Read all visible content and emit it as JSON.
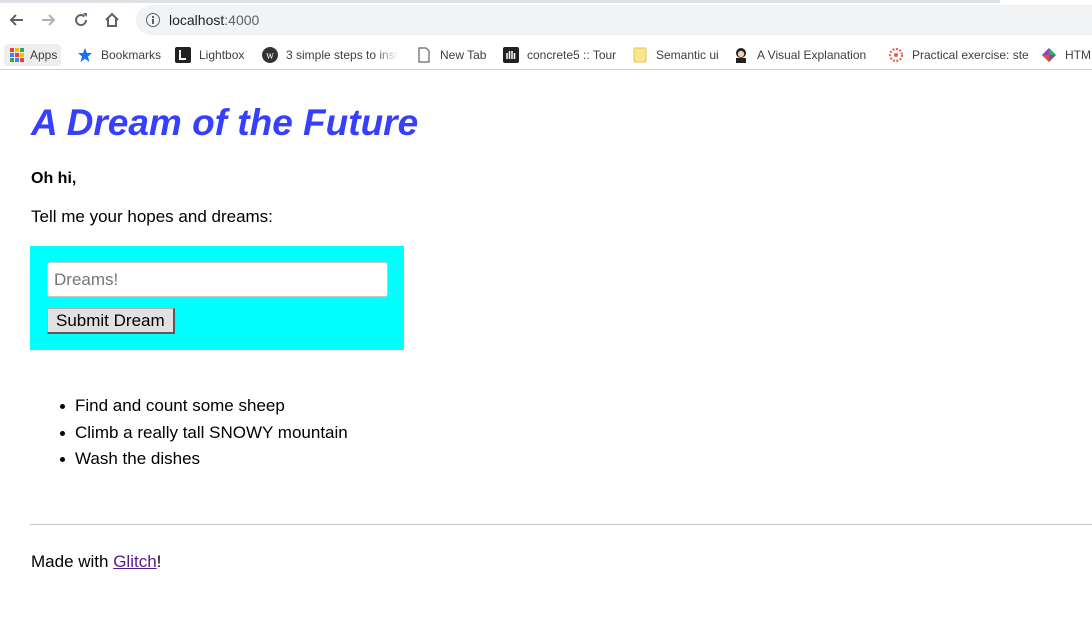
{
  "browser": {
    "url_host": "localhost",
    "url_port": ":4000",
    "bookmarks": [
      {
        "label": "Apps",
        "icon": "apps-grid-icon"
      },
      {
        "label": "Bookmarks",
        "icon": "star-icon"
      },
      {
        "label": "Lightbox",
        "icon": "lightbox-icon"
      },
      {
        "label": "3 simple steps to inst",
        "icon": "wordpress-icon"
      },
      {
        "label": "New Tab",
        "icon": "page-icon"
      },
      {
        "label": "concrete5 :: Tour",
        "icon": "concrete5-icon"
      },
      {
        "label": "Semantic ui",
        "icon": "folder-icon"
      },
      {
        "label": "A Visual Explanation",
        "icon": "avatar-icon"
      },
      {
        "label": "Practical exercise: ste",
        "icon": "gear-icon"
      },
      {
        "label": "HTM",
        "icon": "diamond-icon"
      }
    ]
  },
  "page": {
    "title": "A Dream of the Future",
    "greeting": "Oh hi,",
    "prompt": "Tell me your hopes and dreams:",
    "form": {
      "input_placeholder": "Dreams!",
      "input_value": "",
      "submit_label": "Submit Dream"
    },
    "dreams": [
      "Find and count some sheep",
      "Climb a really tall SNOWY mountain",
      "Wash the dishes"
    ],
    "footer": {
      "prefix": "Made with ",
      "link_text": "Glitch",
      "suffix": "!"
    }
  },
  "colors": {
    "title": "#373fff",
    "form_background": "#00ffff",
    "link_visited": "#551a8b"
  }
}
